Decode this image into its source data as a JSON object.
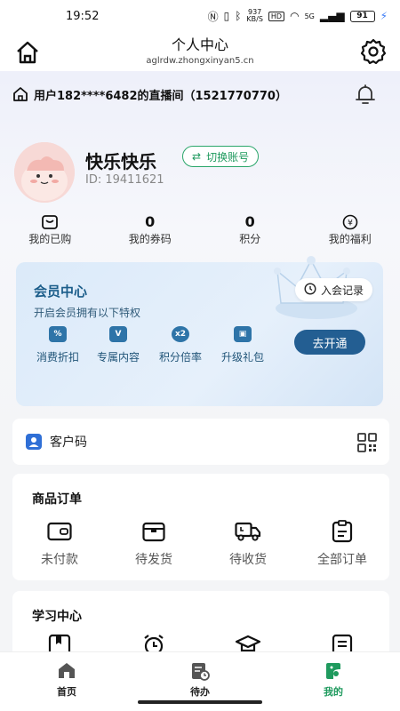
{
  "status_bar": {
    "time": "19:52",
    "net_speed": "937\nKB/S",
    "hd": "HD",
    "signal": "5G",
    "battery": "91"
  },
  "title_bar": {
    "title": "个人中心",
    "url": "aglrdw.zhongxinyan5.cn"
  },
  "live": {
    "text": "用户182****6482的直播间（1521770770）"
  },
  "profile": {
    "name": "快乐快乐",
    "switch_label": "切换账号",
    "id_text": "ID: 19411621"
  },
  "stats": [
    {
      "label": "我的已购",
      "value": ""
    },
    {
      "label": "我的券码",
      "value": "0"
    },
    {
      "label": "积分",
      "value": "0"
    },
    {
      "label": "我的福利",
      "value": ""
    }
  ],
  "member": {
    "title": "会员中心",
    "subtitle": "开启会员拥有以下特权",
    "record_label": "入会记录",
    "open_label": "去开通",
    "perks": [
      {
        "label": "消费折扣",
        "icon_text": "%"
      },
      {
        "label": "专属内容",
        "icon_text": "V"
      },
      {
        "label": "积分倍率",
        "icon_text": "x2"
      },
      {
        "label": "升级礼包",
        "icon_text": ""
      }
    ]
  },
  "customer_code": {
    "label": "客户码"
  },
  "orders": {
    "title": "商品订单",
    "items": [
      {
        "label": "未付款"
      },
      {
        "label": "待发货"
      },
      {
        "label": "待收货"
      },
      {
        "label": "全部订单"
      }
    ]
  },
  "study": {
    "title": "学习中心"
  },
  "tabs": [
    {
      "label": "首页"
    },
    {
      "label": "待办"
    },
    {
      "label": "我的"
    }
  ],
  "colors": {
    "accent_green": "#1f9a5e",
    "member_blue": "#235e92"
  }
}
